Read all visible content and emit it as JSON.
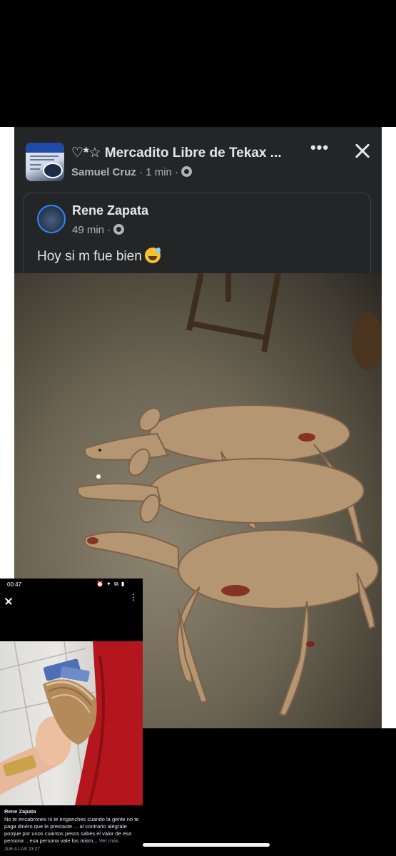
{
  "post": {
    "group_title": "♡*☆ Mercadito Libre de Tekax ...",
    "author": "Samuel Cruz",
    "time": "1 min",
    "separator": "·",
    "more_label": "•••"
  },
  "shared_post": {
    "author": "Rene Zapata",
    "time": "49 min",
    "text": "Hoy si m fue bien"
  },
  "inset": {
    "status_time": "00:47",
    "status_icons": "⏰ ✦ ⧉ ▮",
    "menu_label": "⋮",
    "author": "Rene Zapata",
    "caption": "No te encabrones ni te enganches cuando la gente no te paga dinero que le prestaste ... al contrario alégrate porque por unos cuantos pesos sabes el valor de esa persona .. esa persona vale los mism...",
    "see_more": "Ver más",
    "date": "JUE A LAS 23:27"
  },
  "colors": {
    "card_bg": "#242526",
    "text_primary": "#e4e6eb",
    "text_secondary": "#b0b3b8",
    "accent": "#2d88ff"
  }
}
